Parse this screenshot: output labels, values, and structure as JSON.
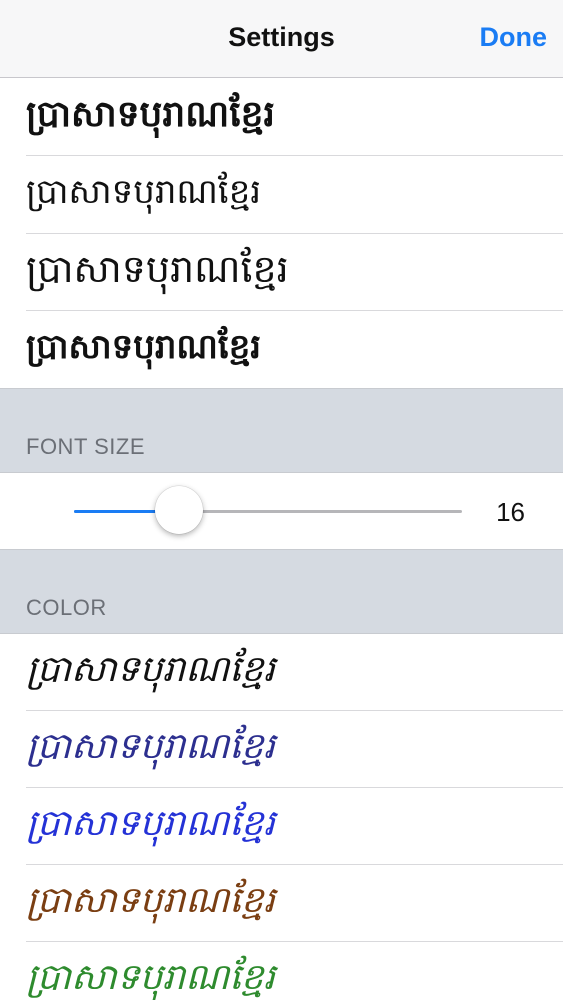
{
  "nav": {
    "title": "Settings",
    "done_label": "Done"
  },
  "fonts": [
    {
      "sample": "ប្រាសាទបុរាណខ្មែរ"
    },
    {
      "sample": "ប្រាសាទបុរាណខ្មែរ"
    },
    {
      "sample": "ប្រាសាទបុរាណខ្មែរ"
    },
    {
      "sample": "ប្រាសាទបុរាណខ្មែរ"
    }
  ],
  "font_size": {
    "header": "FONT SIZE",
    "value": "16",
    "fraction": 0.27
  },
  "color": {
    "header": "COLOR",
    "options": [
      {
        "sample": "ប្រាសាទបុរាណខ្មែរ",
        "color": "#111111"
      },
      {
        "sample": "ប្រាសាទបុរាណខ្មែរ",
        "color": "#2c2f8f"
      },
      {
        "sample": "ប្រាសាទបុរាណខ្មែរ",
        "color": "#2432d6"
      },
      {
        "sample": "ប្រាសាទបុរាណខ្មែរ",
        "color": "#7a3e12"
      },
      {
        "sample": "ប្រាសាទបុរាណខ្មែរ",
        "color": "#2e8b2e"
      }
    ]
  },
  "accent": "#1a7cf4"
}
